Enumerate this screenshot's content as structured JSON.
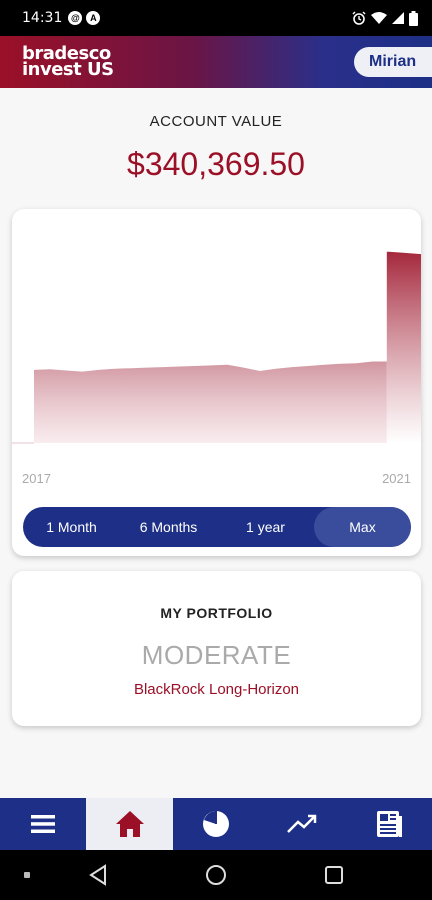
{
  "status": {
    "time": "14:31",
    "left_icons": [
      "at-sign-icon",
      "location-a-icon"
    ],
    "right_icons": [
      "alarm-icon",
      "wifi-icon",
      "signal-icon",
      "battery-icon"
    ]
  },
  "header": {
    "logo_line1": "bradesco",
    "logo_line2": "invest US",
    "user_name": "Mirian",
    "colors": {
      "brand_red": "#9b1027",
      "brand_blue": "#1d2f86"
    }
  },
  "account": {
    "title": "ACCOUNT VALUE",
    "value": "$340,369.50"
  },
  "chart": {
    "start_label": "2017",
    "end_label": "2021",
    "ranges": [
      "1 Month",
      "6 Months",
      "1 year",
      "Max"
    ],
    "selected_range": "Max"
  },
  "chart_data": {
    "type": "area",
    "title": "",
    "xlabel": "",
    "ylabel": "",
    "x_range": [
      "2017",
      "2021"
    ],
    "grid": false,
    "series": [
      {
        "values": [
          130000,
          131000,
          129000,
          127000,
          130000,
          132000,
          133000,
          134000,
          135000,
          136000,
          137000,
          138000,
          139000,
          134000,
          128000,
          132000,
          135000,
          137000,
          139000,
          141000,
          142000,
          145000,
          340000,
          338000,
          336000
        ]
      }
    ]
  },
  "portfolio": {
    "title": "MY PORTFOLIO",
    "profile": "MODERATE",
    "model": "BlackRock Long-Horizon"
  },
  "bottom_nav": {
    "items": [
      "menu-icon",
      "home-icon",
      "pie-chart-icon",
      "trend-icon",
      "news-icon"
    ],
    "active": "home-icon"
  },
  "android_nav": [
    "back-icon",
    "home-circle-icon",
    "recents-icon"
  ]
}
